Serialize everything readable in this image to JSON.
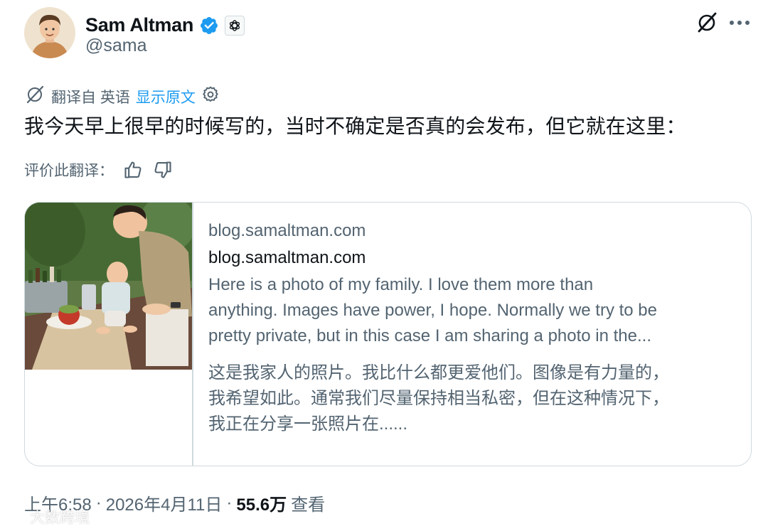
{
  "author": {
    "display_name": "Sam Altman",
    "handle": "@sama",
    "verified": true
  },
  "translation": {
    "label": "翻译自 英语",
    "show_original": "显示原文"
  },
  "tweet": {
    "text": "我今天早上很早的时候写的，当时不确定是否真的会发布，但它就在这里："
  },
  "rate": {
    "label": "评价此翻译："
  },
  "card": {
    "domain": "blog.samaltman.com",
    "title": "blog.samaltman.com",
    "description_lines": [
      "Here is a photo of my family. I love them more than",
      "anything. Images have power, I hope. Normally we try to be",
      "pretty private, but in this case I am sharing a photo in the..."
    ],
    "description_cn_lines": [
      "这是我家人的照片。我比什么都更爱他们。图像是有力量的，",
      "我希望如此。通常我们尽量保持相当私密，但在这种情况下，",
      "我正在分享一张照片在......"
    ]
  },
  "meta": {
    "time": "上午6:58",
    "sep1": "·",
    "date": "2026年4月11日",
    "sep2": "·",
    "views": "55.6万",
    "views_label": "查看"
  },
  "watermark": {
    "text": "大数跨境"
  },
  "colors": {
    "accent": "#1d9bf0",
    "secondary_text": "#536471",
    "primary_text": "#0f1419",
    "border": "#cfd9de"
  },
  "icons": {
    "verified": "verified-badge-icon",
    "affiliation": "openai-logo-icon",
    "grok": "grok-icon",
    "more": "more-dots-icon",
    "translate": "translate-icon",
    "settings": "gear-icon",
    "thumbs_up": "thumbs-up-icon",
    "thumbs_down": "thumbs-down-icon"
  }
}
